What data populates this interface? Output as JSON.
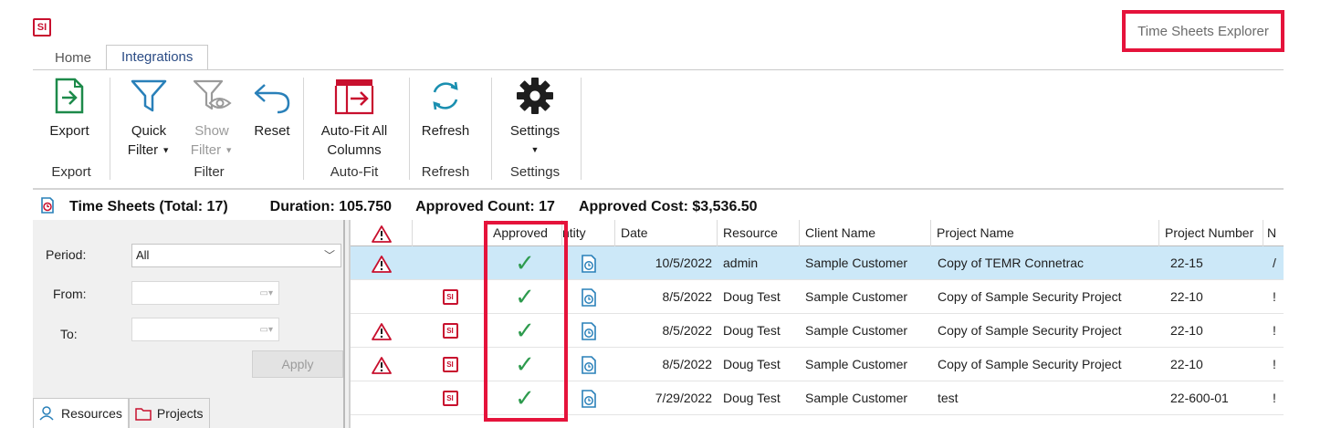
{
  "app": {
    "logo_text": "SI",
    "explorer_title": "Time Sheets Explorer"
  },
  "ribbon": {
    "tabs": [
      {
        "label": "Home"
      },
      {
        "label": "Integrations"
      }
    ],
    "buttons": {
      "export": "Export",
      "quick_filter_1": "Quick",
      "quick_filter_2": "Filter",
      "show_filter_1": "Show",
      "show_filter_2": "Filter",
      "reset": "Reset",
      "autofit_1": "Auto-Fit All",
      "autofit_2": "Columns",
      "refresh": "Refresh",
      "settings": "Settings"
    },
    "groups": {
      "export": "Export",
      "filter": "Filter",
      "autofit": "Auto-Fit",
      "refresh": "Refresh",
      "settings": "Settings"
    },
    "colors": {
      "accent_red": "#c8102e",
      "export_green": "#1d8a4a",
      "filter_blue": "#2980b9",
      "highlight": "#e5133b"
    }
  },
  "summary": {
    "total": "Time Sheets (Total: 17)",
    "duration": "Duration: 105.750",
    "approved_count": "Approved Count: 17",
    "approved_cost": "Approved Cost: $3,536.50"
  },
  "filters": {
    "period_label": "Period:",
    "period_value": "All",
    "from_label": "From:",
    "to_label": "To:",
    "apply_label": "Apply",
    "tabs": [
      {
        "label": "Resources"
      },
      {
        "label": "Projects"
      }
    ]
  },
  "grid": {
    "columns": {
      "warning": "",
      "source": "",
      "approved": "Approved",
      "entity": "ntity",
      "date": "Date",
      "resource": "Resource",
      "client": "Client Name",
      "project": "Project Name",
      "project_number": "Project Number",
      "next": "N"
    },
    "rows": [
      {
        "warning": true,
        "si": false,
        "approved": "✓",
        "date": "10/5/2022",
        "resource": "admin",
        "client": "Sample Customer",
        "project": "Copy of TEMR Connetrac",
        "project_number": "22-15",
        "next": "/",
        "selected": true
      },
      {
        "warning": false,
        "si": true,
        "approved": "✓",
        "date": "8/5/2022",
        "resource": "Doug Test",
        "client": "Sample Customer",
        "project": "Copy of Sample Security Project",
        "project_number": "22-10",
        "next": "!",
        "selected": false
      },
      {
        "warning": true,
        "si": true,
        "approved": "✓",
        "date": "8/5/2022",
        "resource": "Doug Test",
        "client": "Sample Customer",
        "project": "Copy of Sample Security Project",
        "project_number": "22-10",
        "next": "!",
        "selected": false
      },
      {
        "warning": true,
        "si": true,
        "approved": "✓",
        "date": "8/5/2022",
        "resource": "Doug Test",
        "client": "Sample Customer",
        "project": "Copy of Sample Security Project",
        "project_number": "22-10",
        "next": "!",
        "selected": false
      },
      {
        "warning": false,
        "si": true,
        "approved": "✓",
        "date": "7/29/2022",
        "resource": "Doug Test",
        "client": "Sample Customer",
        "project": "test",
        "project_number": "22-600-01",
        "next": "!",
        "selected": false
      }
    ]
  }
}
